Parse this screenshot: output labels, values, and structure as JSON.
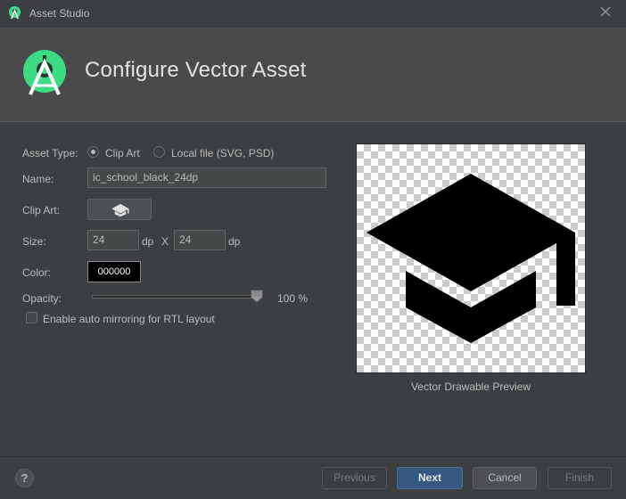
{
  "window": {
    "title": "Asset Studio",
    "close_icon": "close-icon",
    "app_icon": "android-studio-icon"
  },
  "header": {
    "title": "Configure Vector Asset",
    "logo_icon": "android-studio-logo"
  },
  "form": {
    "asset_type_label": "Asset Type:",
    "asset_type_options": [
      "Clip Art",
      "Local file (SVG, PSD)"
    ],
    "asset_type_selected": "Clip Art",
    "name_label": "Name:",
    "name_value": "ic_school_black_24dp",
    "clip_art_label": "Clip Art:",
    "clip_art_icon": "school-icon",
    "size_label": "Size:",
    "width_value": "24",
    "height_value": "24",
    "unit": "dp",
    "size_separator": "X",
    "color_label": "Color:",
    "color_value": "000000",
    "opacity_label": "Opacity:",
    "opacity_value": "100 %",
    "opacity_percent": 100,
    "rtl_label": "Enable auto mirroring for RTL layout",
    "rtl_checked": false
  },
  "preview": {
    "caption": "Vector Drawable Preview",
    "icon": "school-icon"
  },
  "footer": {
    "help_label": "?",
    "previous_label": "Previous",
    "next_label": "Next",
    "cancel_label": "Cancel",
    "finish_label": "Finish"
  },
  "colors": {
    "background": "#3c3f41",
    "header_bg": "#4a4a4a",
    "accent": "#3ddc84",
    "primary_button": "#365880"
  }
}
